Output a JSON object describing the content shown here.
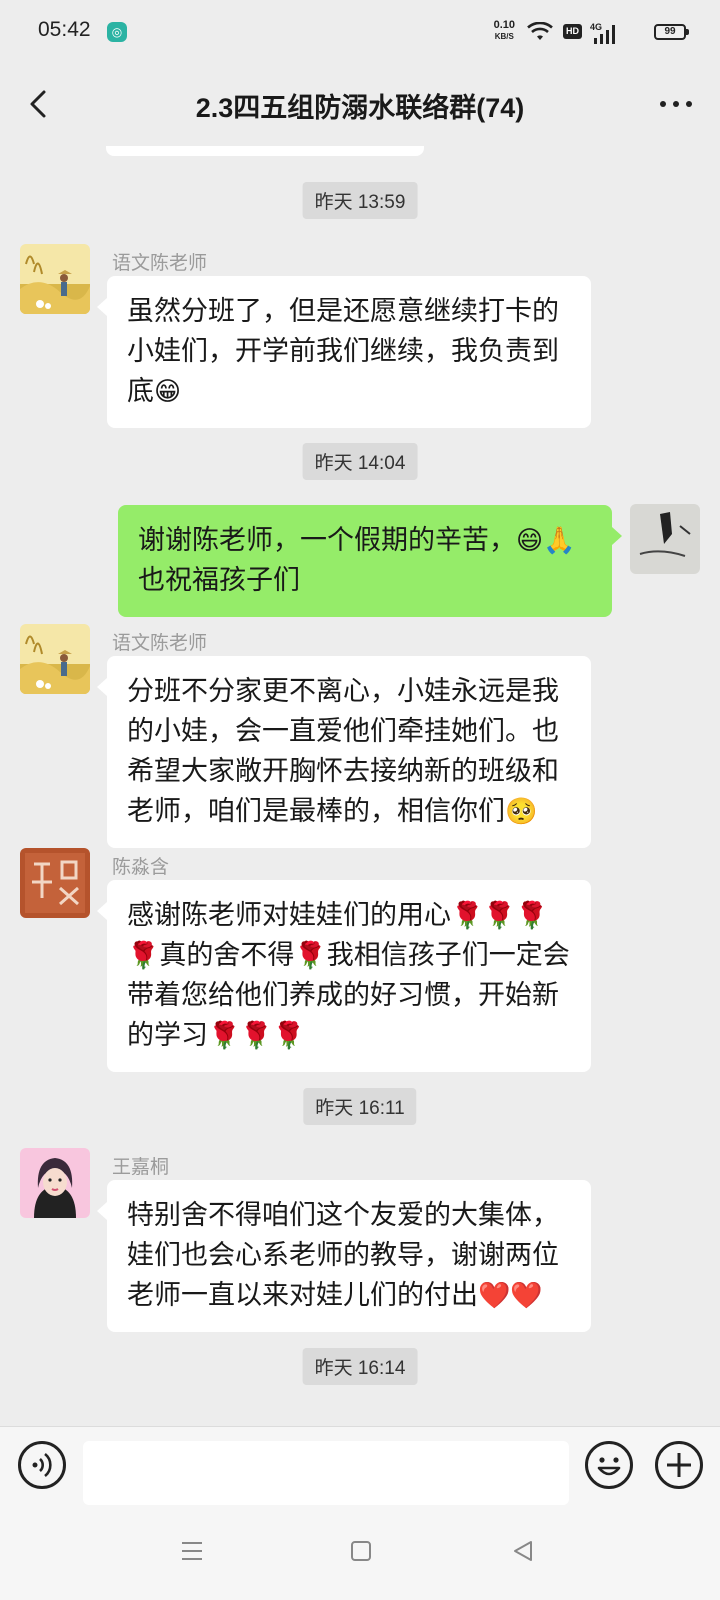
{
  "status_bar": {
    "time": "05:42",
    "net_speed_value": "0.10",
    "net_speed_unit": "KB/S",
    "hd": "HD",
    "signal": "4G",
    "battery": "99"
  },
  "header": {
    "title": "2.3四五组防溺水联络群(74)"
  },
  "messages": [
    {
      "type": "time",
      "text": "昨天 13:59"
    },
    {
      "type": "received",
      "sender": "语文陈老师",
      "text": "虽然分班了，但是还愿意继续打卡的小娃们，开学前我们继续，我负责到底",
      "emoji": "😁"
    },
    {
      "type": "time",
      "text": "昨天 14:04"
    },
    {
      "type": "sent",
      "text": "谢谢陈老师，一个假期的辛苦，",
      "emoji": "😄🙏",
      "text2": "也祝福孩子们"
    },
    {
      "type": "received",
      "sender": "语文陈老师",
      "text": "分班不分家更不离心，小娃永远是我的小娃，会一直爱他们牵挂她们。也希望大家敞开胸怀去接纳新的班级和老师，咱们是最棒的，相信你们",
      "emoji": "🥺"
    },
    {
      "type": "received",
      "sender": "陈淼含",
      "text_parts": [
        "感谢陈老师对娃娃们的用心",
        "🌹🌹🌹🌹",
        "真的舍不得",
        "🌹",
        "我相信孩子们一定会带着您给他们养成的好习惯，开始新的学习",
        "🌹🌹🌹"
      ]
    },
    {
      "type": "time",
      "text": "昨天 16:11"
    },
    {
      "type": "received",
      "sender": "王嘉桐",
      "text": "特别舍不得咱们这个友爱的大集体，娃们也会心系老师的教导，谢谢两位老师一直以来对娃儿们的付出",
      "emoji": "❤️❤️"
    },
    {
      "type": "time",
      "text": "昨天 16:14"
    }
  ],
  "input_bar": {
    "placeholder": ""
  },
  "colors": {
    "background": "#ededed",
    "sent_bubble": "#95ec69",
    "received_bubble": "#ffffff",
    "time_pill": "#dadada"
  },
  "icons": [
    "back-icon",
    "more-icon",
    "voice-icon",
    "emoji-icon",
    "plus-icon",
    "menu-icon",
    "home-icon",
    "back-triangle-icon"
  ]
}
